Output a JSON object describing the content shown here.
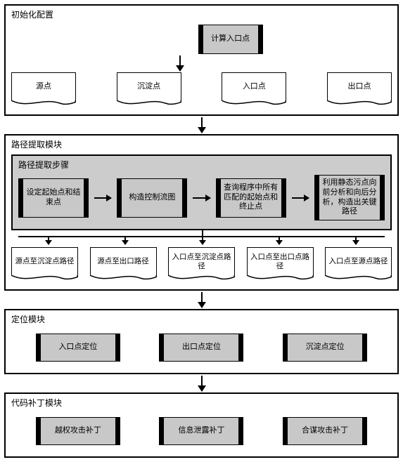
{
  "init": {
    "title": "初始化配置",
    "compute_entry": "计算入口点",
    "docs": [
      "源点",
      "沉淀点",
      "入口点",
      "出口点"
    ]
  },
  "extract": {
    "title": "路径提取模块",
    "steps_title": "路径提取步骤",
    "steps": [
      "设定起始点和结束点",
      "构造控制流图",
      "查询程序中所有匹配的起始点和终止点",
      "利用静态污点向前分析和向后分析，构造出关键路径"
    ],
    "outputs": [
      "源点至沉淀点路径",
      "源点至出口路径",
      "入口点至沉淀点路径",
      "入口点至出口点路径",
      "入口点至源点路径"
    ]
  },
  "locate": {
    "title": "定位模块",
    "items": [
      "入口点定位",
      "出口点定位",
      "沉淀点定位"
    ]
  },
  "patch": {
    "title": "代码补丁模块",
    "items": [
      "越权攻击补丁",
      "信息泄露补丁",
      "合谋攻击补丁"
    ]
  }
}
